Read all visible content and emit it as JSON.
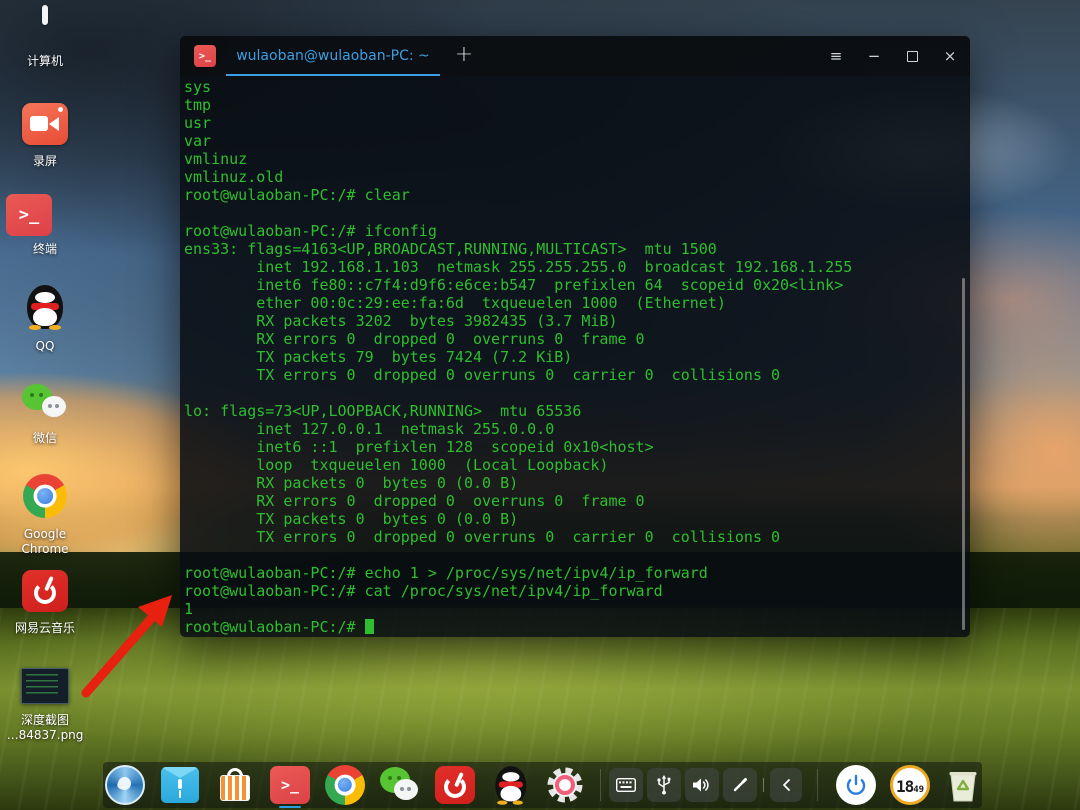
{
  "colors": {
    "terminal-green": "#2fbe2f",
    "tab-blue": "#3c9fe2",
    "dock-indicator-blue": "#2a9fe0",
    "arrow-red": "#e8200f",
    "clock-ring-orange": "#eda921"
  },
  "desktop": {
    "icons": [
      {
        "name": "computer",
        "label": "计算机"
      },
      {
        "name": "screen-recorder",
        "label": "录屏"
      },
      {
        "name": "terminal",
        "label": "终端"
      },
      {
        "name": "qq",
        "label": "QQ"
      },
      {
        "name": "wechat",
        "label": "微信"
      },
      {
        "name": "google-chrome",
        "label": "Google Chrome"
      },
      {
        "name": "netease-music",
        "label": "网易云音乐"
      },
      {
        "name": "screenshot-file",
        "label": "深度截图\n…84837.png"
      }
    ]
  },
  "terminal_window": {
    "tab_title": "wulaoban@wulaoban-PC: ~",
    "new_tab_label": "+",
    "window_controls": {
      "menu": "≡",
      "minimize": "−",
      "maximize": "",
      "close": "×"
    },
    "lines": [
      "sys",
      "tmp",
      "usr",
      "var",
      "vmlinuz",
      "vmlinuz.old",
      "root@wulaoban-PC:/# clear",
      "",
      "root@wulaoban-PC:/# ifconfig",
      "ens33: flags=4163<UP,BROADCAST,RUNNING,MULTICAST>  mtu 1500",
      "        inet 192.168.1.103  netmask 255.255.255.0  broadcast 192.168.1.255",
      "        inet6 fe80::c7f4:d9f6:e6ce:b547  prefixlen 64  scopeid 0x20<link>",
      "        ether 00:0c:29:ee:fa:6d  txqueuelen 1000  (Ethernet)",
      "        RX packets 3202  bytes 3982435 (3.7 MiB)",
      "        RX errors 0  dropped 0  overruns 0  frame 0",
      "        TX packets 79  bytes 7424 (7.2 KiB)",
      "        TX errors 0  dropped 0 overruns 0  carrier 0  collisions 0",
      "",
      "lo: flags=73<UP,LOOPBACK,RUNNING>  mtu 65536",
      "        inet 127.0.0.1  netmask 255.0.0.0",
      "        inet6 ::1  prefixlen 128  scopeid 0x10<host>",
      "        loop  txqueuelen 1000  (Local Loopback)",
      "        RX packets 0  bytes 0 (0.0 B)",
      "        RX errors 0  dropped 0  overruns 0  frame 0",
      "        TX packets 0  bytes 0 (0.0 B)",
      "        TX errors 0  dropped 0 overruns 0  carrier 0  collisions 0",
      "",
      "root@wulaoban-PC:/# echo 1 > /proc/sys/net/ipv4/ip_forward",
      "root@wulaoban-PC:/# cat /proc/sys/net/ipv4/ip_forward",
      "1",
      "root@wulaoban-PC:/# "
    ],
    "cursor_on_last_line": true
  },
  "dock": {
    "apps": [
      {
        "name": "launcher"
      },
      {
        "name": "file-manager"
      },
      {
        "name": "app-store"
      },
      {
        "name": "terminal",
        "active": true
      },
      {
        "name": "google-chrome"
      },
      {
        "name": "wechat"
      },
      {
        "name": "netease-music"
      },
      {
        "name": "qq"
      },
      {
        "name": "control-center"
      }
    ],
    "tray": [
      {
        "name": "keyboard"
      },
      {
        "name": "usb"
      },
      {
        "name": "volume"
      },
      {
        "name": "screenshot"
      }
    ],
    "collapse_chevron": "‹",
    "clock": {
      "hour": "18",
      "minute": "49"
    }
  }
}
